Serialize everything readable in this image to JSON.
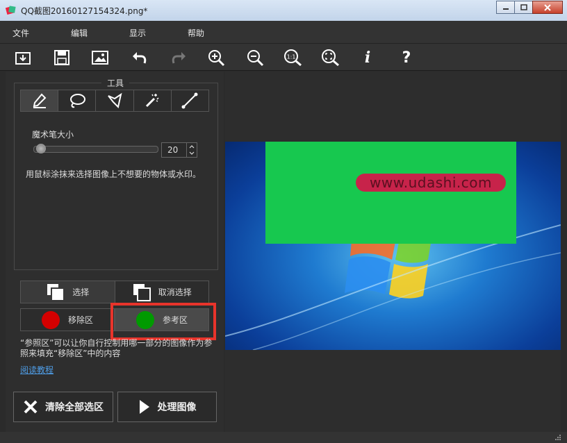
{
  "window": {
    "title": "QQ截图20160127154324.png*"
  },
  "menu": [
    "文件",
    "编辑",
    "显示",
    "帮助"
  ],
  "toolbar": {
    "icons": [
      "open-icon",
      "save-icon",
      "image-icon",
      "undo-icon",
      "redo-icon",
      "zoom-in-icon",
      "zoom-out-icon",
      "actual-size-icon",
      "fit-icon",
      "info-icon",
      "help-icon"
    ],
    "zoom_actual_label": "1:1",
    "info_label": "i",
    "help_label": "?"
  },
  "tools": {
    "legend": "工具",
    "brush_size_label": "魔术笔大小",
    "brush_size_value": "20",
    "brush_size_fraction": 0.05,
    "hint": "用鼠标涂抹来选择图像上不想要的物体或水印。"
  },
  "selection": {
    "select_label": "选择",
    "deselect_label": "取消选择"
  },
  "regions": {
    "remove_label": "移除区",
    "reference_label": "参考区",
    "remove_color": "#d40000",
    "reference_color": "#009a00",
    "description": "“参照区”可以让你自行控制用哪一部分的图像作为参照来填充“移除区”中的内容"
  },
  "tutorial_link": "阅读教程",
  "actions": {
    "clear_label": "清除全部选区",
    "process_label": "处理图像"
  },
  "canvas": {
    "watermark_text": "www.udashi.com"
  }
}
